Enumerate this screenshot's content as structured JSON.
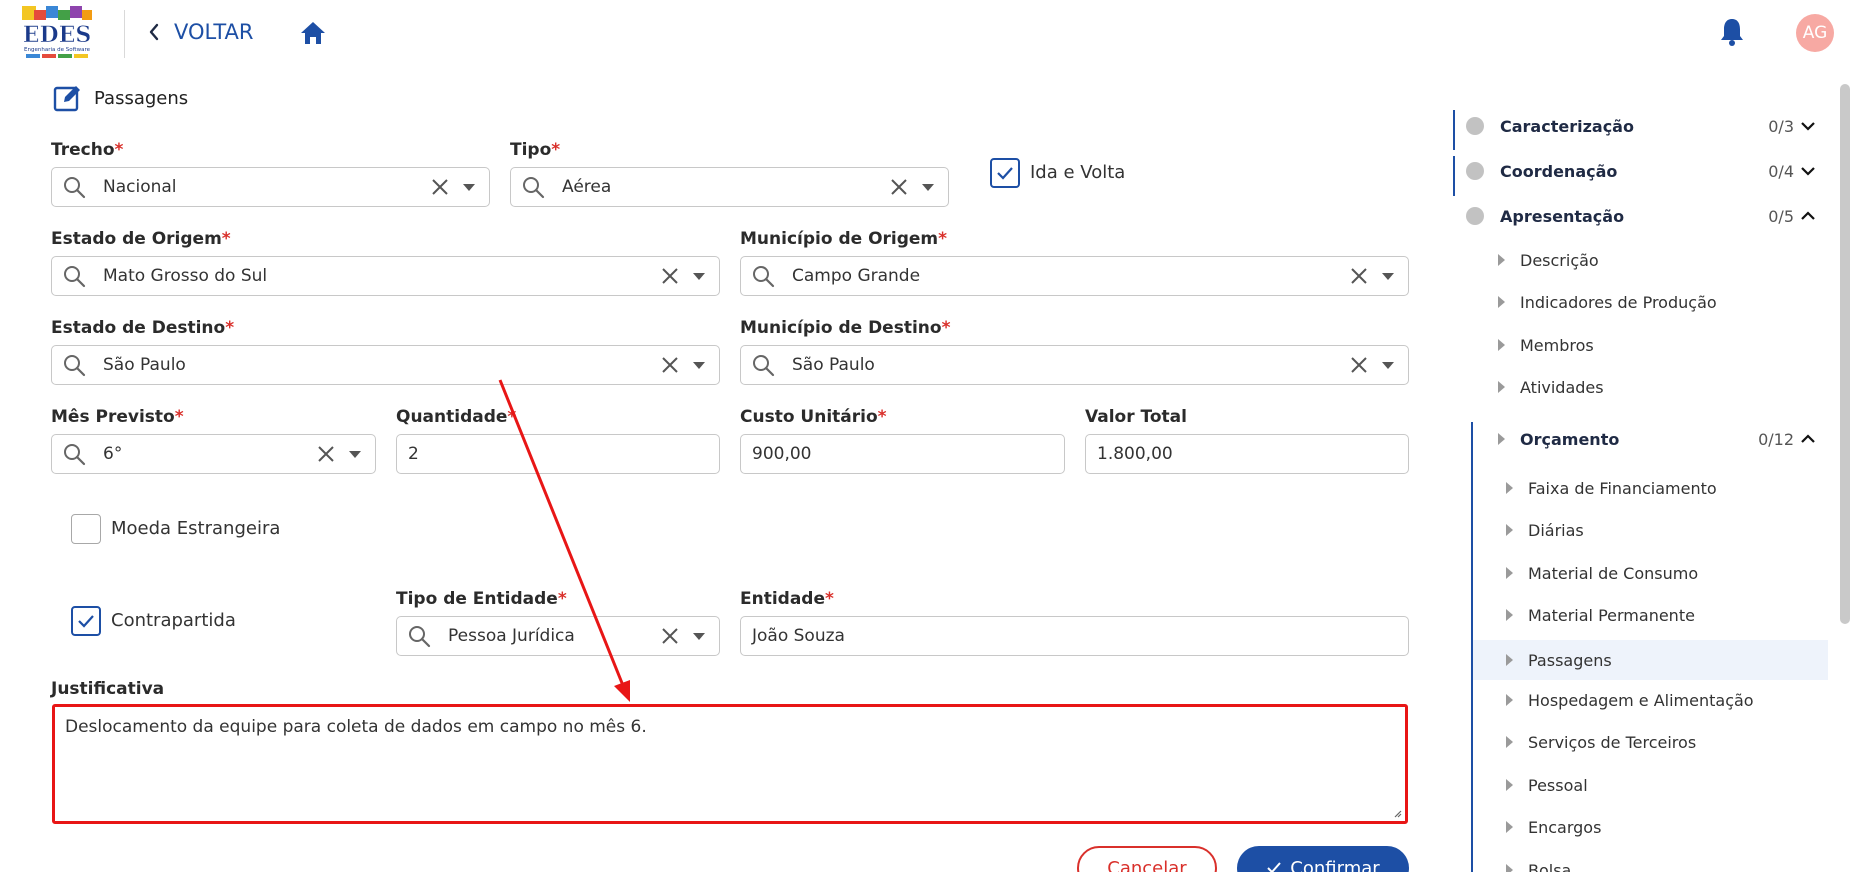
{
  "header": {
    "back_label": "VOLTAR",
    "avatar_initials": "AG",
    "logo_text": "EDES",
    "logo_subtitle": "Engenharia de Software"
  },
  "section": {
    "title": "Passagens"
  },
  "form": {
    "trecho": {
      "label": "Trecho",
      "value": "Nacional"
    },
    "tipo": {
      "label": "Tipo",
      "value": "Aérea"
    },
    "ida_volta": {
      "label": "Ida e Volta",
      "checked": true
    },
    "estado_origem": {
      "label": "Estado de Origem",
      "value": "Mato Grosso do Sul"
    },
    "municipio_origem": {
      "label": "Município de Origem",
      "value": "Campo Grande"
    },
    "estado_destino": {
      "label": "Estado de Destino",
      "value": "São Paulo"
    },
    "municipio_destino": {
      "label": "Município de Destino",
      "value": "São Paulo"
    },
    "mes_previsto": {
      "label": "Mês Previsto",
      "value": "6°"
    },
    "quantidade": {
      "label": "Quantidade",
      "value": "2"
    },
    "custo_unitario": {
      "label": "Custo Unitário",
      "value": "900,00"
    },
    "valor_total": {
      "label": "Valor Total",
      "value": "1.800,00"
    },
    "moeda_estrangeira": {
      "label": "Moeda Estrangeira",
      "checked": false
    },
    "contrapartida": {
      "label": "Contrapartida",
      "checked": true
    },
    "tipo_entidade": {
      "label": "Tipo de Entidade",
      "value": "Pessoa Jurídica"
    },
    "entidade": {
      "label": "Entidade",
      "value": "João Souza"
    },
    "justificativa": {
      "label": "Justificativa",
      "value": "Deslocamento da equipe para coleta de dados em campo no mês 6."
    },
    "required_mark": "*"
  },
  "actions": {
    "cancel_label": "Cancelar",
    "confirm_label": "Confirmar"
  },
  "sidebar": {
    "groups": [
      {
        "label": "Caracterização",
        "count": "0/3"
      },
      {
        "label": "Coordenação",
        "count": "0/4"
      },
      {
        "label": "Apresentação",
        "count": "0/5"
      }
    ],
    "apresentacao_items": [
      "Descrição",
      "Indicadores de Produção",
      "Membros",
      "Atividades"
    ],
    "orcamento": {
      "label": "Orçamento",
      "count": "0/12"
    },
    "orcamento_items": [
      "Faixa de Financiamento",
      "Diárias",
      "Material de Consumo",
      "Material Permanente",
      "Passagens",
      "Hospedagem e Alimentação",
      "Serviços de Terceiros",
      "Pessoal",
      "Encargos",
      "Bolsa"
    ],
    "active_item": "Passagens"
  },
  "colors": {
    "primary": "#1d4fa5",
    "required": "#d9302b",
    "highlight": "#e81616",
    "avatar_bg": "#f7a9a3"
  }
}
